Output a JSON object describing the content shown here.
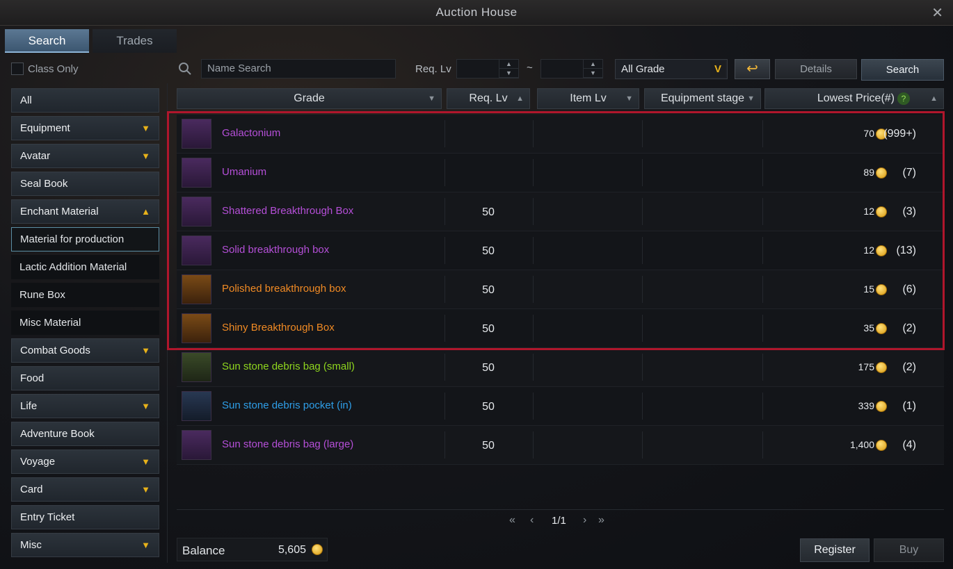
{
  "window": {
    "title": "Auction House"
  },
  "tabs": [
    {
      "label": "Search",
      "active": true
    },
    {
      "label": "Trades",
      "active": false
    }
  ],
  "filters": {
    "class_only_label": "Class Only",
    "name_search_placeholder": "Name Search",
    "req_lv_label": "Req. Lv",
    "range_separator": "~",
    "grade_value": "All Grade",
    "details_label": "Details",
    "search_label": "Search"
  },
  "sidebar": {
    "items": [
      {
        "label": "All",
        "type": "category",
        "arrow": ""
      },
      {
        "label": "Equipment",
        "type": "category",
        "arrow": "▼"
      },
      {
        "label": "Avatar",
        "type": "category",
        "arrow": "▼"
      },
      {
        "label": "Seal Book",
        "type": "category",
        "arrow": ""
      },
      {
        "label": "Enchant Material",
        "type": "category",
        "arrow": "▲"
      },
      {
        "label": "Material for production",
        "type": "sub",
        "selected": true
      },
      {
        "label": "Lactic Addition Material",
        "type": "sub"
      },
      {
        "label": "Rune Box",
        "type": "sub"
      },
      {
        "label": "Misc Material",
        "type": "sub"
      },
      {
        "label": "Combat Goods",
        "type": "category",
        "arrow": "▼"
      },
      {
        "label": "Food",
        "type": "category",
        "arrow": ""
      },
      {
        "label": "Life",
        "type": "category",
        "arrow": "▼"
      },
      {
        "label": "Adventure Book",
        "type": "category",
        "arrow": ""
      },
      {
        "label": "Voyage",
        "type": "category",
        "arrow": "▼"
      },
      {
        "label": "Card",
        "type": "category",
        "arrow": "▼"
      },
      {
        "label": "Entry Ticket",
        "type": "category",
        "arrow": ""
      },
      {
        "label": "Misc",
        "type": "category",
        "arrow": "▼"
      }
    ]
  },
  "table": {
    "headers": {
      "grade": "Grade",
      "req_lv": "Req. Lv",
      "item_lv": "Item Lv",
      "equipment_stage": "Equipment stage",
      "lowest_price": "Lowest Price(#)",
      "help": "?"
    },
    "rows": [
      {
        "name": "Galactonium",
        "color": "#b54fd8",
        "icon": "blue-crystal-icon",
        "icon_bg": "purple",
        "req_lv": "",
        "price": "70",
        "count": "(999+)"
      },
      {
        "name": "Umanium",
        "color": "#b54fd8",
        "icon": "orange-crystal-icon",
        "icon_bg": "purple",
        "req_lv": "",
        "price": "89",
        "count": "(7)"
      },
      {
        "name": "Shattered Breakthrough Box",
        "color": "#b54fd8",
        "icon": "chest-icon",
        "icon_bg": "purple",
        "req_lv": "50",
        "price": "12",
        "count": "(3)"
      },
      {
        "name": "Solid breakthrough box",
        "color": "#b54fd8",
        "icon": "chest-icon",
        "icon_bg": "purple",
        "req_lv": "50",
        "price": "12",
        "count": "(13)"
      },
      {
        "name": "Polished breakthrough box",
        "color": "#f08a24",
        "icon": "chest-icon",
        "icon_bg": "orange",
        "req_lv": "50",
        "price": "15",
        "count": "(6)"
      },
      {
        "name": "Shiny Breakthrough Box",
        "color": "#f08a24",
        "icon": "chest-icon",
        "icon_bg": "orange",
        "req_lv": "50",
        "price": "35",
        "count": "(2)"
      },
      {
        "name": "Sun stone debris bag (small)",
        "color": "#8fd61e",
        "icon": "green-bag-icon",
        "icon_bg": "green",
        "req_lv": "50",
        "price": "175",
        "count": "(2)"
      },
      {
        "name": "Sun stone debris pocket (in)",
        "color": "#2e9ee8",
        "icon": "blue-bag-icon",
        "icon_bg": "blue",
        "req_lv": "50",
        "price": "339",
        "count": "(1)"
      },
      {
        "name": "Sun stone debris bag (large)",
        "color": "#b54fd8",
        "icon": "red-bag-icon",
        "icon_bg": "red",
        "req_lv": "50",
        "price": "1,400",
        "count": "(4)"
      }
    ]
  },
  "pagination": {
    "label": "1/1"
  },
  "footer": {
    "balance_label": "Balance",
    "balance_value": "5,605",
    "register_label": "Register",
    "buy_label": "Buy"
  }
}
